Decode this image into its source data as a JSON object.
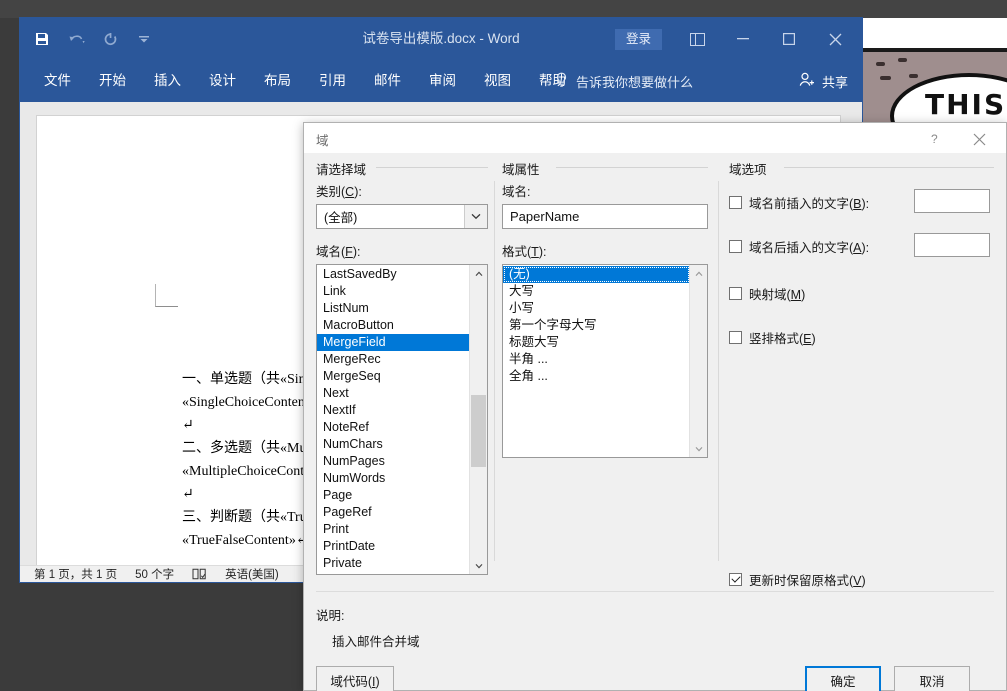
{
  "word": {
    "title": "试卷导出模版.docx  -  Word",
    "signin_label": "登录",
    "quick_access": [
      {
        "name": "save-icon",
        "label": "保存"
      },
      {
        "name": "undo-icon",
        "label": "撤消"
      },
      {
        "name": "redo-icon",
        "label": "恢复"
      },
      {
        "name": "customize-qat-icon",
        "label": "自定义快速访问工具栏"
      }
    ],
    "window_controls": [
      {
        "name": "ribbon-display-options-icon",
        "label": "功能区显示选项"
      },
      {
        "name": "minimize-icon",
        "label": "最小化"
      },
      {
        "name": "maximize-icon",
        "label": "最大化"
      },
      {
        "name": "close-icon",
        "label": "关闭"
      }
    ],
    "tabs": [
      "文件",
      "开始",
      "插入",
      "设计",
      "布局",
      "引用",
      "邮件",
      "审阅",
      "视图",
      "帮助"
    ],
    "tell_me": "告诉我你想要做什么",
    "share": "共享",
    "status": {
      "page": "第 1 页，共 1 页",
      "words": "50 个字",
      "proofing_icon": "proofing-errors-icon",
      "language": "英语(美国)"
    },
    "document_lines": [
      "一、单选题（共«SingleCh",
      "«SingleChoiceContent»↵",
      "↵",
      "二、多选题（共«Multiple",
      "«MultipleChoiceContent»",
      "↵",
      "三、判断题（共«TrueFals",
      "«TrueFalseContent»↵"
    ]
  },
  "wallpaper": {
    "text": "THIS"
  },
  "dialog": {
    "title": "域",
    "help_icon": "help-question-icon",
    "close_icon": "close-icon",
    "groups": {
      "select_field": "请选择域",
      "field_properties": "域属性",
      "field_options": "域选项"
    },
    "category": {
      "label": "类别(C):",
      "label_text": "类别(",
      "label_key": "C",
      "label_tail": "):",
      "value": "(全部)"
    },
    "field_names": {
      "label_text": "域名(",
      "label_key": "F",
      "label_tail": "):",
      "items": [
        "LastSavedBy",
        "Link",
        "ListNum",
        "MacroButton",
        "MergeField",
        "MergeRec",
        "MergeSeq",
        "Next",
        "NextIf",
        "NoteRef",
        "NumChars",
        "NumPages",
        "NumWords",
        "Page",
        "PageRef",
        "Print",
        "PrintDate",
        "Private"
      ],
      "selected": "MergeField",
      "selected_index": 4
    },
    "field_name": {
      "label": "域名:",
      "value": "PaperName"
    },
    "format": {
      "label_text": "格式(",
      "label_key": "T",
      "label_tail": "):",
      "items": [
        "(无)",
        "大写",
        "小写",
        "第一个字母大写",
        "标题大写",
        "半角 ...",
        "全角 ..."
      ],
      "selected": "(无)",
      "selected_index": 0
    },
    "options": [
      {
        "name": "text-before-field",
        "text": "域名前插入的文字(",
        "key": "B",
        "tail": "):",
        "checked": false,
        "has_input": true,
        "input_value": ""
      },
      {
        "name": "text-after-field",
        "text": "域名后插入的文字(",
        "key": "A",
        "tail": "):",
        "checked": false,
        "has_input": true,
        "input_value": ""
      },
      {
        "name": "mapped-field",
        "text": "映射域(",
        "key": "M",
        "tail": ")",
        "checked": false,
        "has_input": false
      },
      {
        "name": "vertical-format",
        "text": "竖排格式(",
        "key": "E",
        "tail": ")",
        "checked": false,
        "has_input": false
      }
    ],
    "preserve_formatting": {
      "text": "更新时保留原格式(",
      "key": "V",
      "tail": ")",
      "checked": true
    },
    "description": {
      "label": "说明:",
      "text": "插入邮件合并域"
    },
    "buttons": {
      "field_codes_text": "域代码(",
      "field_codes_key": "I",
      "field_codes_tail": ")",
      "ok": "确定",
      "cancel": "取消"
    }
  },
  "colors": {
    "word_blue": "#2b579a",
    "selection_blue": "#0078d7",
    "dialog_bg": "#f0f0f0"
  }
}
